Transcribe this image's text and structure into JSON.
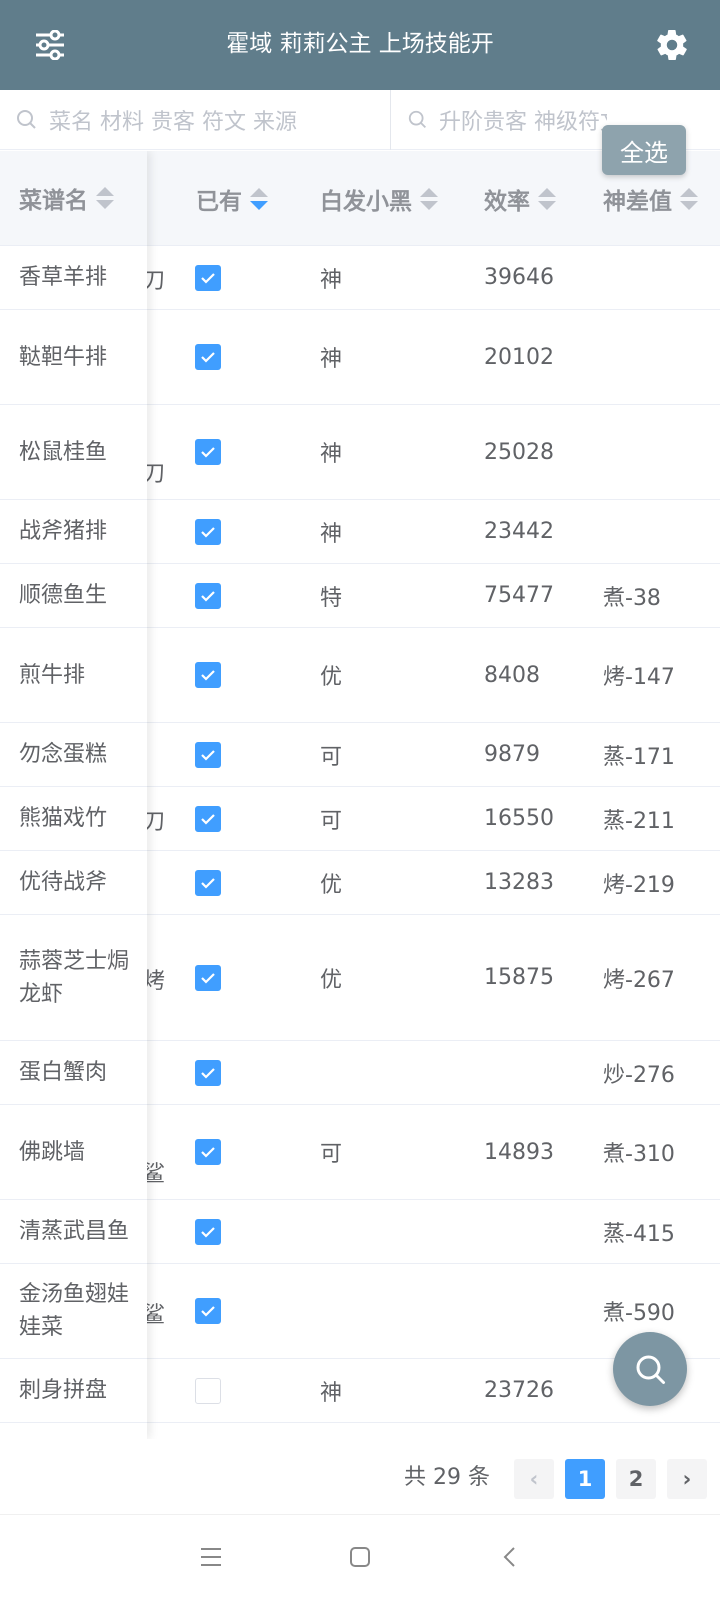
{
  "header": {
    "title": "霍域 莉莉公主 上场技能开",
    "left_icon": "filter-sliders-icon",
    "right_icon": "gear-icon"
  },
  "search": {
    "placeholder_left": "菜名 材料 贵客 符文 来源",
    "placeholder_right": "升阶贵客 神级符文"
  },
  "select_all_label": "全选",
  "table": {
    "headers": {
      "name": "菜谱名",
      "owned": "已有",
      "chef": "白发小黑",
      "efficiency": "效率",
      "god_diff": "神差值"
    },
    "rows": [
      {
        "name": "香草羊排",
        "hidden": "刀",
        "owned": true,
        "rank": "神",
        "efficiency": "39646",
        "diff": ""
      },
      {
        "name": "鞑靼牛排",
        "hidden": "",
        "owned": true,
        "rank": "神",
        "efficiency": "20102",
        "diff": ""
      },
      {
        "name": "松鼠桂鱼",
        "hidden": "刀",
        "owned": true,
        "rank": "神",
        "efficiency": "25028",
        "diff": ""
      },
      {
        "name": "战斧猪排",
        "hidden": "",
        "owned": true,
        "rank": "神",
        "efficiency": "23442",
        "diff": ""
      },
      {
        "name": "顺德鱼生",
        "hidden": "",
        "owned": true,
        "rank": "特",
        "efficiency": "75477",
        "diff": "煮-38"
      },
      {
        "name": "煎牛排",
        "hidden": "",
        "owned": true,
        "rank": "优",
        "efficiency": "8408",
        "diff": "烤-147"
      },
      {
        "name": "勿念蛋糕",
        "hidden": "",
        "owned": true,
        "rank": "可",
        "efficiency": "9879",
        "diff": "蒸-171"
      },
      {
        "name": "熊猫戏竹",
        "hidden": "刀",
        "owned": true,
        "rank": "可",
        "efficiency": "16550",
        "diff": "蒸-211"
      },
      {
        "name": "优待战斧",
        "hidden": "",
        "owned": true,
        "rank": "优",
        "efficiency": "13283",
        "diff": "烤-219"
      },
      {
        "name": "蒜蓉芝士焗龙虾",
        "hidden": "烤",
        "owned": true,
        "rank": "优",
        "efficiency": "15875",
        "diff": "烤-267"
      },
      {
        "name": "蛋白蟹肉",
        "hidden": "",
        "owned": true,
        "rank": "",
        "efficiency": "",
        "diff": "炒-276"
      },
      {
        "name": "佛跳墙",
        "hidden": "鲨",
        "owned": true,
        "rank": "可",
        "efficiency": "14893",
        "diff": "煮-310"
      },
      {
        "name": "清蒸武昌鱼",
        "hidden": "",
        "owned": true,
        "rank": "",
        "efficiency": "",
        "diff": "蒸-415"
      },
      {
        "name": "金汤鱼翅娃娃菜",
        "hidden": "鲨",
        "owned": true,
        "rank": "",
        "efficiency": "",
        "diff": "煮-590"
      },
      {
        "name": "刺身拼盘",
        "hidden": "",
        "owned": false,
        "rank": "神",
        "efficiency": "23726",
        "diff": ""
      }
    ]
  },
  "pagination": {
    "total": "共 29 条",
    "prev": "‹",
    "pages": [
      "1",
      "2"
    ],
    "current": "1",
    "next": "›"
  },
  "fab_icon": "search-icon",
  "navbar": {
    "menu_icon": "menu-icon",
    "home_icon": "home-square-icon",
    "back_icon": "back-chevron-icon"
  }
}
